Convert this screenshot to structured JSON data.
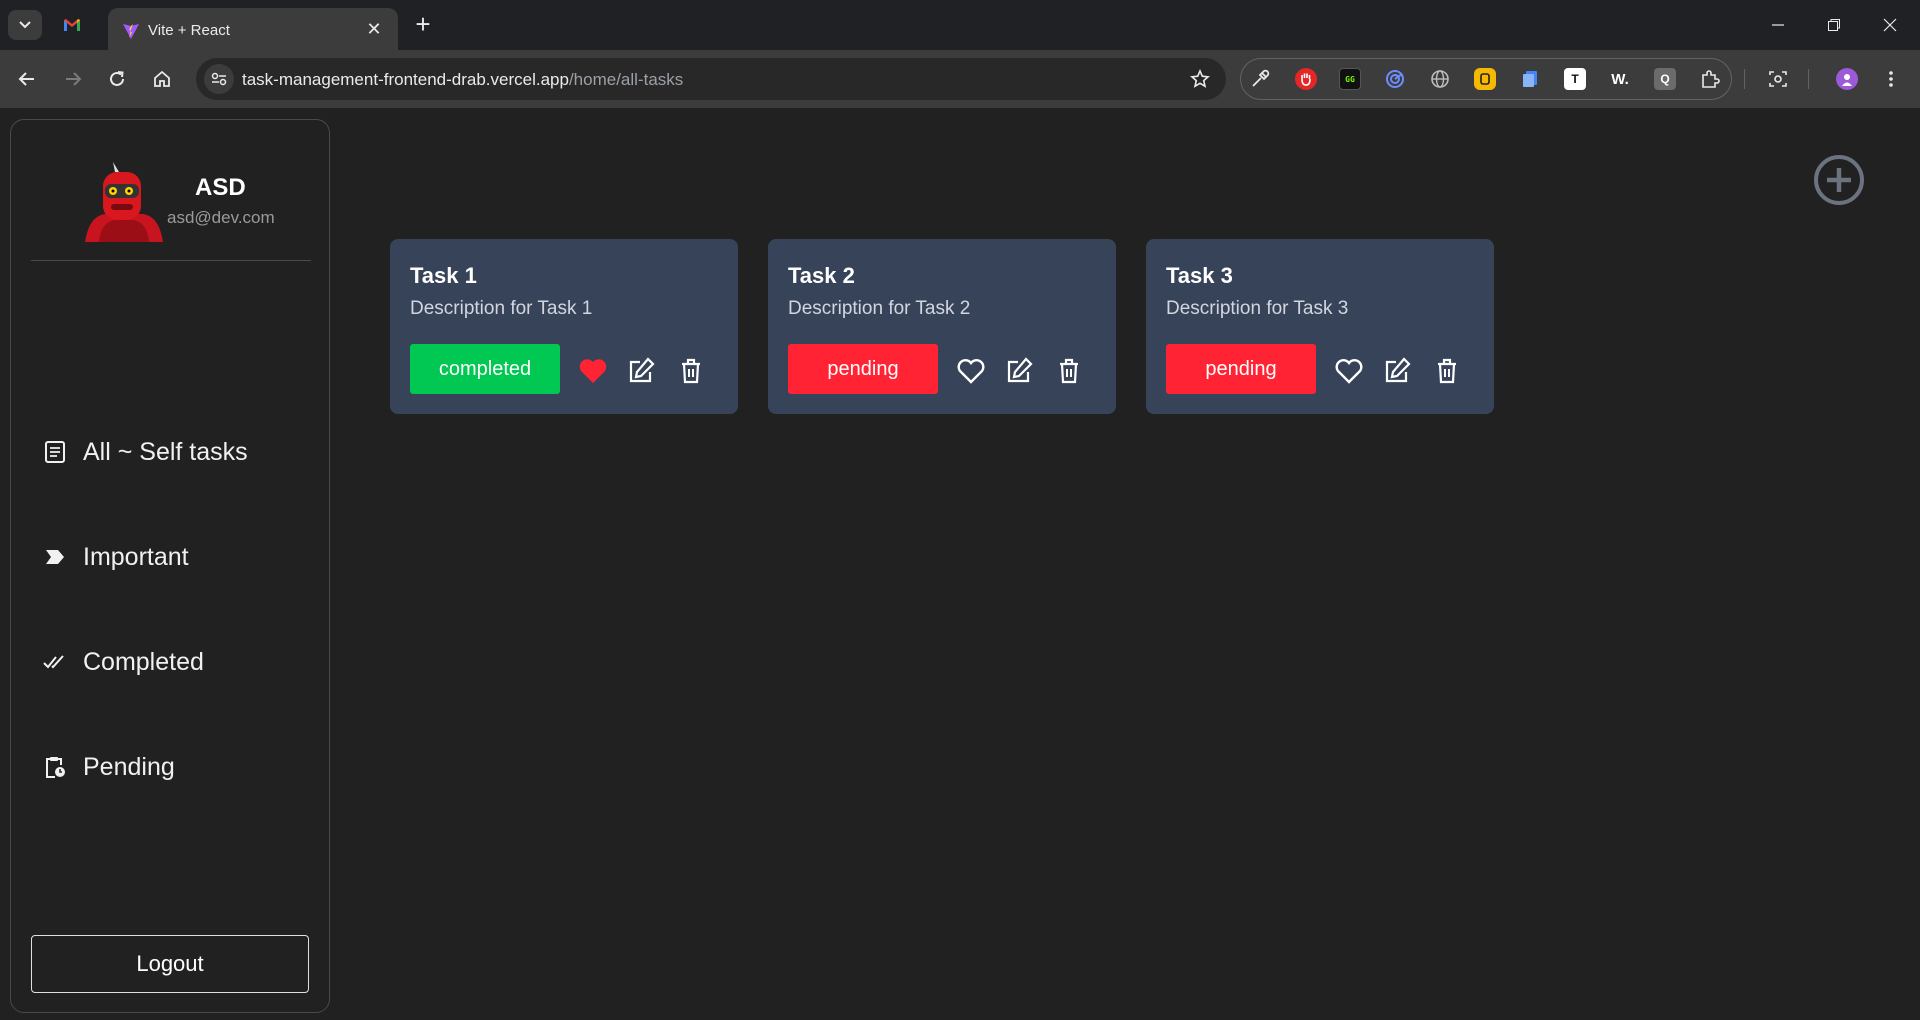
{
  "browser": {
    "tab_title": "Vite + React",
    "url_host": "task-management-frontend-drab.vercel.app",
    "url_path": "/home/all-tasks",
    "extensions": [
      "eyedropper-icon",
      "hand-stop-icon",
      "terminal-icon",
      "radar-icon",
      "globe-icon",
      "note-icon",
      "docs-icon",
      "t-icon",
      "w-icon",
      "q-icon",
      "puzzle-icon"
    ]
  },
  "sidebar": {
    "user": {
      "name": "ASD",
      "email": "asd@dev.com"
    },
    "items": [
      {
        "label": "All ~ Self tasks",
        "icon": "list-icon"
      },
      {
        "label": "Important",
        "icon": "tag-icon"
      },
      {
        "label": "Completed",
        "icon": "double-check-icon"
      },
      {
        "label": "Pending",
        "icon": "clipboard-clock-icon"
      }
    ],
    "logout_label": "Logout"
  },
  "tasks": [
    {
      "title": "Task 1",
      "description": "Description for Task 1",
      "status": "completed",
      "status_color": "#00c853",
      "favorite": true
    },
    {
      "title": "Task 2",
      "description": "Description for Task 2",
      "status": "pending",
      "status_color": "#ff2334",
      "favorite": false
    },
    {
      "title": "Task 3",
      "description": "Description for Task 3",
      "status": "pending",
      "status_color": "#ff2334",
      "favorite": false
    }
  ],
  "colors": {
    "heart_active": "#ff2334",
    "card_bg": "#374358"
  }
}
